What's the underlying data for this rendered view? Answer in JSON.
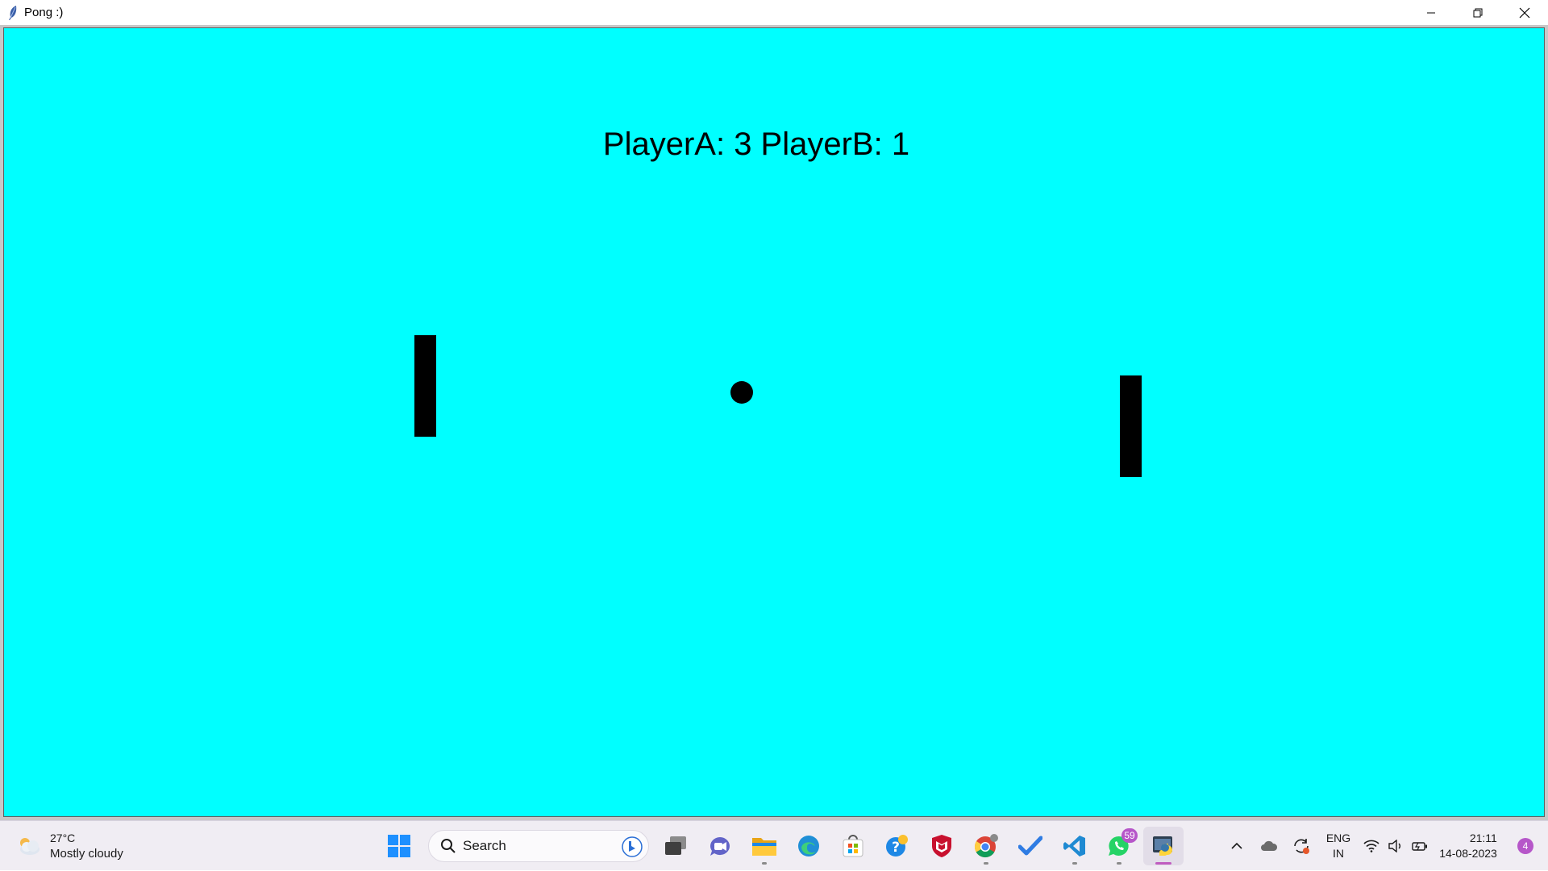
{
  "window": {
    "title": "Pong :)",
    "icon": "feather-icon",
    "controls": [
      "minimize-icon",
      "restore-icon",
      "close-icon"
    ]
  },
  "game": {
    "score_text": "PlayerA: 3 PlayerB: 1",
    "background": "#00ffff",
    "object_color": "#000000"
  },
  "taskbar": {
    "weather": {
      "temp": "27°C",
      "desc": "Mostly cloudy",
      "icon": "cloud-icon"
    },
    "search": {
      "placeholder": "Search"
    },
    "apps": [
      "start-icon",
      "task-view-icon",
      "teams-chat-icon",
      "file-explorer-icon",
      "edge-icon",
      "store-icon",
      "help-icon",
      "mcafee-icon",
      "chrome-icon",
      "todo-icon",
      "vscode-icon",
      "whatsapp-icon",
      "python-icon"
    ],
    "whatsapp_badge": "59",
    "tray": {
      "lang_line1": "ENG",
      "lang_line2": "IN",
      "time": "21:11",
      "date": "14-08-2023",
      "notifications": "4"
    }
  }
}
